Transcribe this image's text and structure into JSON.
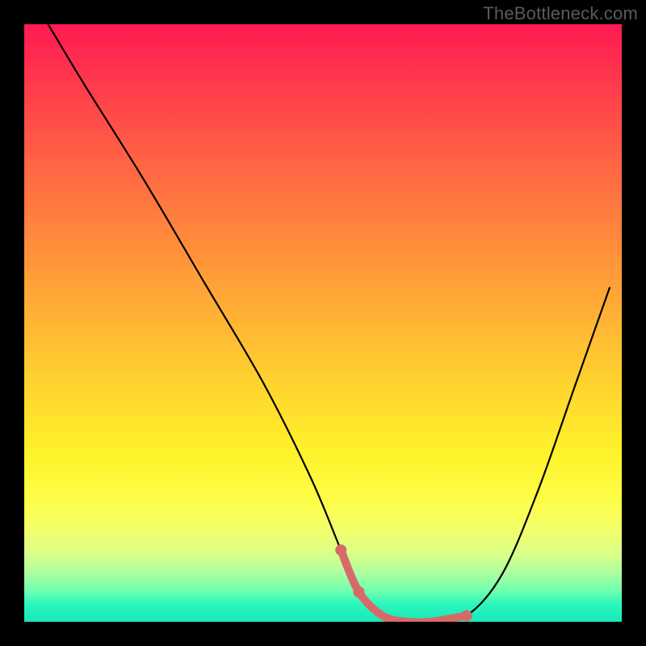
{
  "watermark": "TheBottleneck.com",
  "colors": {
    "frame_bg": "#000000",
    "gradient_top": "#ff1a52",
    "gradient_mid": "#ffd82e",
    "gradient_bottom": "#18e8b8",
    "curve_stroke": "#000000",
    "marker_stroke": "#d66a6a",
    "marker_fill": "#d66a6a"
  },
  "chart_data": {
    "type": "line",
    "title": "",
    "xlabel": "",
    "ylabel": "",
    "xlim": [
      0,
      100
    ],
    "ylim": [
      0,
      100
    ],
    "series": [
      {
        "name": "bottleneck-curve",
        "x": [
          4,
          10,
          20,
          30,
          40,
          48,
          53,
          56,
          60,
          64,
          68,
          74,
          80,
          86,
          92,
          98
        ],
        "y": [
          100,
          90,
          74,
          57,
          40,
          24,
          12,
          5,
          1,
          0,
          0,
          1,
          8,
          22,
          39,
          56
        ]
      }
    ],
    "highlight_segment": {
      "name": "optimal-range",
      "x": [
        53,
        56,
        60,
        64,
        68,
        74
      ],
      "y": [
        12,
        5,
        1,
        0,
        0,
        1
      ]
    },
    "highlight_markers": [
      {
        "x": 53,
        "y": 12
      },
      {
        "x": 56,
        "y": 5
      },
      {
        "x": 74,
        "y": 1
      }
    ]
  }
}
